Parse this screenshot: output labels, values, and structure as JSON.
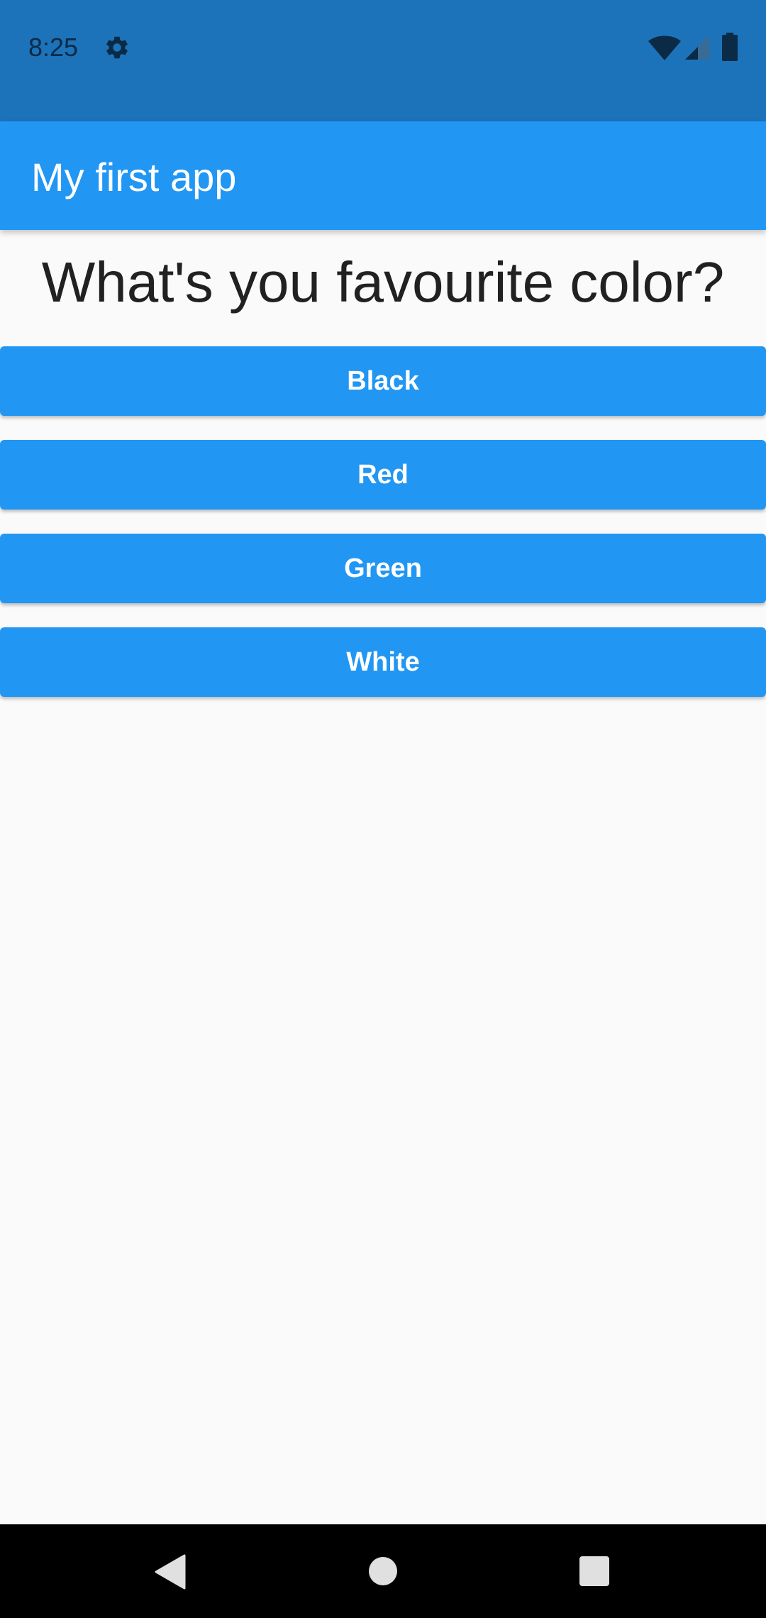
{
  "status_bar": {
    "time": "8:25",
    "icons": [
      "gear-icon",
      "wifi-icon",
      "signal-icon",
      "battery-icon"
    ],
    "color": "#1c73ba"
  },
  "app_bar": {
    "title": "My first app",
    "color": "#2196f3"
  },
  "main": {
    "question": "What's you favourite color?",
    "buttons": [
      {
        "label": "Black"
      },
      {
        "label": "Red"
      },
      {
        "label": "Green"
      },
      {
        "label": "White"
      }
    ],
    "button_color": "#2196f3"
  },
  "nav_bar": {
    "icons": [
      "back-icon",
      "home-icon",
      "recents-icon"
    ]
  }
}
